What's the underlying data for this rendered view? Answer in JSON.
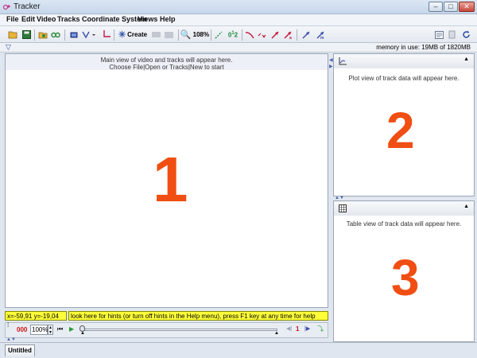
{
  "window": {
    "title": "Tracker",
    "minimize": "–",
    "maximize": "□",
    "close": "✕"
  },
  "menu": [
    "File",
    "Edit",
    "Video",
    "Tracks",
    "Coordinate System",
    "Views",
    "Help"
  ],
  "toolbar": {
    "create_label": "Create",
    "zoom_label": "108%",
    "icons": [
      "open-icon",
      "save-icon",
      "import-video-icon",
      "clip-settings-icon",
      "calibration-icon",
      "coordinate-axes-icon",
      "create-track-icon",
      "zoom-icon"
    ]
  },
  "memory": {
    "text": "memory in use: 19MB of 1820MB"
  },
  "main_view": {
    "hint_line1": "Main view of video and tracks will appear here.",
    "hint_line2": "Choose File|Open or Tracks|New to start",
    "big_label": "1"
  },
  "plot_view": {
    "hint": "Plot view of track data will appear here.",
    "big_label": "2"
  },
  "table_view": {
    "hint": "Table view of track data will appear here.",
    "big_label": "3"
  },
  "status": {
    "coords": "x=-59,91  y=-19,04",
    "hint": "look here for hints (or turn off hints in the Help menu), press F1 key at any time for help"
  },
  "player": {
    "frame_counter": "000",
    "rate": "100%",
    "step_size": "1"
  },
  "tabs": [
    {
      "label": "Untitled"
    }
  ],
  "colors": {
    "accent_orange": "#f04e12",
    "hint_yellow": "#ffff3a"
  }
}
